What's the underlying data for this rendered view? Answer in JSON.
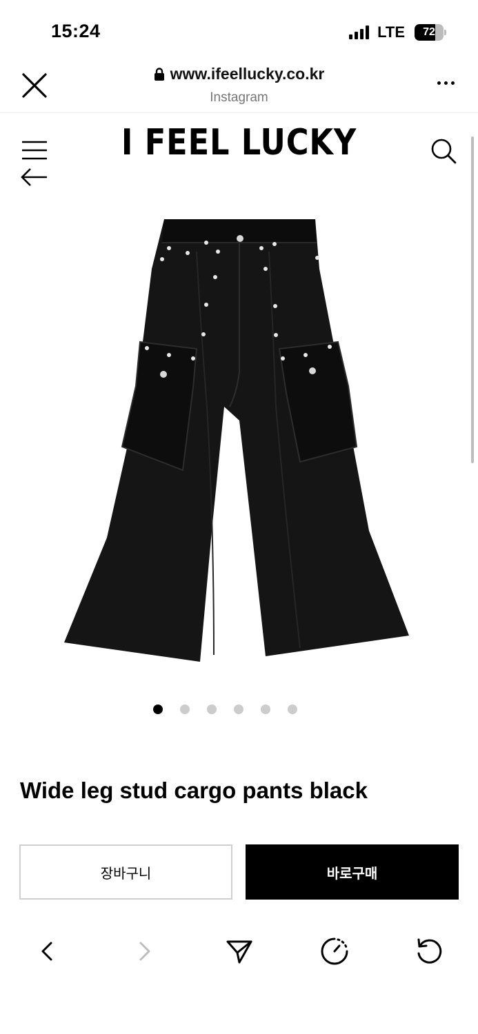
{
  "status_bar": {
    "time": "15:24",
    "network": "LTE",
    "battery": "72",
    "battery_level": 0.72,
    "signal_icon": "cellular-signal-icon"
  },
  "browser": {
    "url": "www.ifeellucky.co.kr",
    "source": "Instagram",
    "close_icon": "close-icon",
    "lock_icon": "lock-icon",
    "more_icon": "more-dots-icon"
  },
  "site": {
    "logo": "I FEEL LUCKY",
    "menu_icon": "hamburger-menu-icon",
    "back_icon": "arrow-left-icon",
    "search_icon": "search-icon"
  },
  "product": {
    "image_alt": "black wide leg stud cargo pants",
    "title": "Wide leg stud cargo pants black",
    "gallery": {
      "total": 6,
      "current": 1
    }
  },
  "actions": {
    "cart_label": "장바구니",
    "buy_label": "바로구매"
  },
  "toolbar": {
    "items": [
      "back-icon",
      "forward-icon",
      "share-icon",
      "speed-icon",
      "reload-icon"
    ]
  },
  "colors": {
    "text": "#000000",
    "muted": "#777777",
    "border": "#cfcfcf",
    "dot_inactive": "#cccccc",
    "buy_bg": "#000000"
  }
}
